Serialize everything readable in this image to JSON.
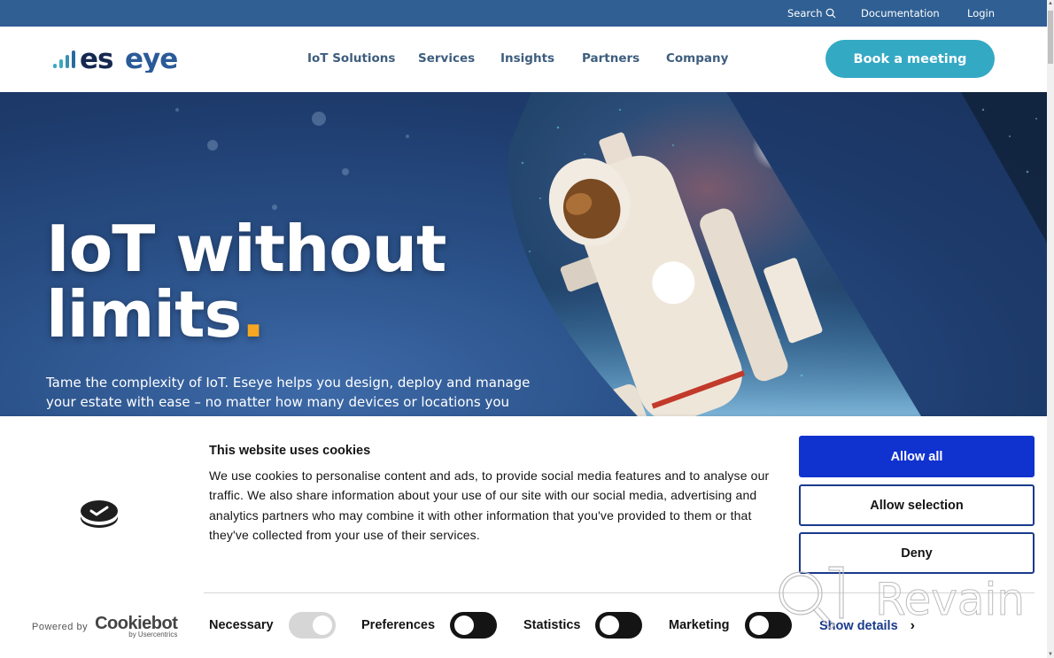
{
  "topbar": {
    "search_label": "Search",
    "search_icon": "search-icon",
    "documentation_label": "Documentation",
    "login_label": "Login"
  },
  "header": {
    "logo_text": "eseye",
    "nav": [
      "IoT Solutions",
      "Services",
      "Insights",
      "Partners",
      "Company"
    ],
    "cta_label": "Book a meeting"
  },
  "hero": {
    "title_line1": "IoT without",
    "title_line2": "limits",
    "title_dot": ".",
    "subtitle": "Tame the complexity of IoT. Eseye helps you design, deploy and manage your estate with ease – no matter how many devices or locations you",
    "image_subject": "astronaut-in-space"
  },
  "cookie_banner": {
    "title": "This website uses cookies",
    "body": "We use cookies to personalise content and ads, to provide social media features and to analyse our traffic. We also share information about your use of our site with our social media, advertising and analytics partners who may combine it with other information that you've provided to them or that they've collected from your use of their services.",
    "buttons": {
      "allow_all": "Allow all",
      "allow_selection": "Allow selection",
      "deny": "Deny"
    },
    "powered_by": "Powered by",
    "provider_name": "Cookiebot",
    "provider_sub": "by Usercentrics",
    "toggles": [
      {
        "label": "Necessary",
        "state": "on",
        "disabled": true
      },
      {
        "label": "Preferences",
        "state": "off",
        "disabled": false
      },
      {
        "label": "Statistics",
        "state": "off",
        "disabled": false
      },
      {
        "label": "Marketing",
        "state": "off",
        "disabled": false
      }
    ],
    "show_details_label": "Show details",
    "chevron": "›"
  },
  "watermark": {
    "text": "Revain"
  },
  "colors": {
    "topbar_bg": "#2f5f93",
    "nav_text": "#3e5e7e",
    "cta_bg": "#34a9c4",
    "accent_dot": "#f5a623",
    "allow_all_bg": "#1032cf",
    "button_border": "#1a3a8a"
  }
}
